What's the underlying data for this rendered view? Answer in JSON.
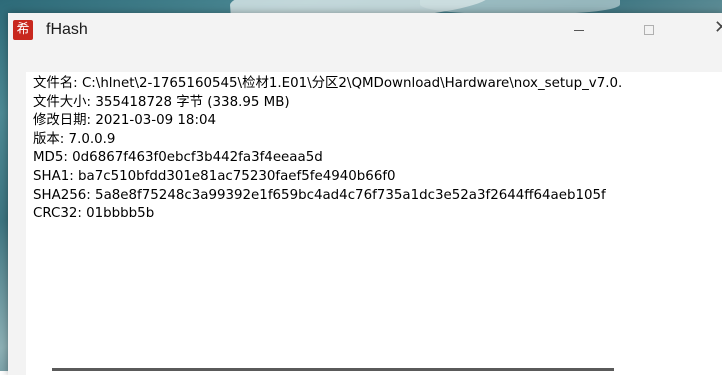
{
  "window": {
    "title": "fHash",
    "app_icon_glyph": "希"
  },
  "controls": {
    "minimize_icon": "minimize-icon",
    "maximize_icon": "maximize-icon",
    "close_glyph": "✕"
  },
  "info": {
    "lines": [
      "文件名: C:\\hlnet\\2-1765160545\\检材1.E01\\分区2\\QMDownload\\Hardware\\nox_setup_v7.0.",
      "文件大小: 355418728 字节 (338.95 MB)",
      "修改日期: 2021-03-09 18:04",
      "版本: 7.0.0.9",
      "MD5: 0d6867f463f0ebcf3b442fa3f4eeaa5d",
      "SHA1: ba7c510bfdd301e81ac75230faef5fe4940b66f0",
      "SHA256: 5a8e8f75248c3a99392e1f659bc4ad4c76f735a1dc3e52a3f2644ff64aeb105f",
      "CRC32: 01bbbb5b"
    ]
  },
  "colors": {
    "app_icon": "#c8281e",
    "titlebar": "#f3f3f3",
    "client_bg": "#ffffff"
  }
}
